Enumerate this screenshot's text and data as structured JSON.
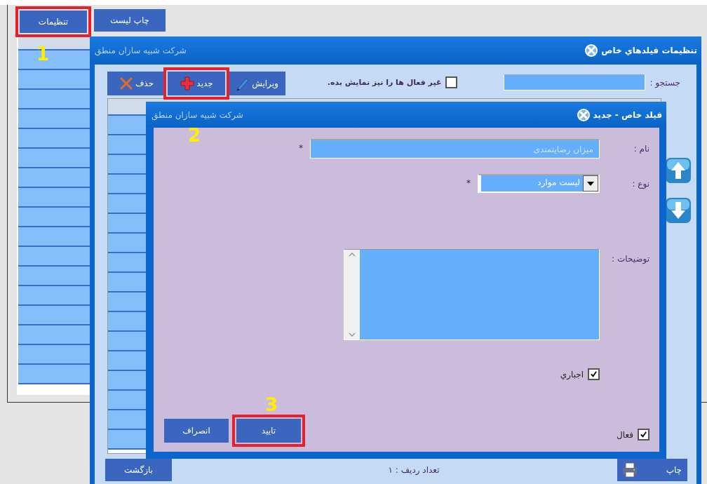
{
  "top_buttons": [
    {
      "label": "چاپ لیست",
      "highlighted": false
    },
    {
      "label": "تنظیمات",
      "highlighted": true
    }
  ],
  "step_markers": [
    "1",
    "2",
    "3"
  ],
  "main_window": {
    "title": "تنظیمات فیلدهاي خاص",
    "company": "شرکت شبیه سازان منطق",
    "search_label": "جستجو :",
    "show_inactive": {
      "label": "غیر فعال ها را نیز نمایش بده.",
      "checked": false
    },
    "actions": [
      {
        "kind": "edit",
        "label": "ویرایش",
        "highlighted": false
      },
      {
        "kind": "new",
        "label": "جدید",
        "highlighted": true
      },
      {
        "kind": "delete",
        "label": "حذف",
        "highlighted": false
      }
    ],
    "footer": {
      "print": "چاپ",
      "row_count": "تعداد ردیف : ۱",
      "back": "بازگشت"
    }
  },
  "dialog": {
    "title": "فیلد خاص - جدید",
    "company": "شرکت شبیه سازان منطق",
    "fields": [
      {
        "kind": "text",
        "label": "نام :",
        "value": "میزان رضایتمندی",
        "required_mark": "*"
      },
      {
        "kind": "select",
        "label": "نوع :",
        "value": "لیست موارد",
        "required_mark": "*"
      },
      {
        "kind": "textarea",
        "label": "توضیحات :"
      }
    ],
    "required_check": {
      "label": "اجباري",
      "checked": true
    },
    "active_check": {
      "label": "فعال",
      "checked": true
    },
    "buttons": [
      {
        "label": "تایید",
        "highlighted": true
      },
      {
        "label": "انصراف",
        "highlighted": false
      }
    ]
  }
}
